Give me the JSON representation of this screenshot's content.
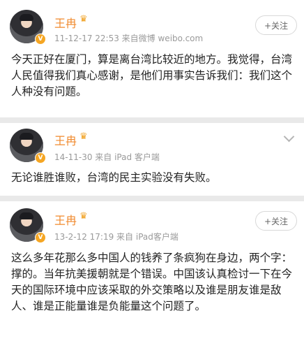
{
  "posts": [
    {
      "username": "王冉",
      "meta": "11-12-17 22:53 来自微博 weibo.com",
      "follow_label": "+关注",
      "content": "今天正好在厦门，算是离台湾比较近的地方。我觉得，台湾人民值得我们真心感谢，是他们用事实告诉我们：我们这个人种没有问题。"
    },
    {
      "username": "王冉",
      "meta": "14-11-30 来自 iPad 客户端",
      "content": "无论谁胜谁败，台湾的民主实验没有失败。"
    },
    {
      "username": "王冉",
      "meta": "13-2-12 17:19 来自 iPad客户端",
      "follow_label": "+关注",
      "content": "这么多年花那么多中国人的钱养了条疯狗在身边，两个字：撑的。当年抗美援朝就是个错误。中国该认真检讨一下在今天的国际环境中应该采取的外交策略以及谁是朋友谁是敌人、谁是正能量谁是负能量这个问题了。"
    }
  ],
  "icons": {
    "verified": "v-badge-icon",
    "member": "member-crown-icon",
    "more": "chevron-down-icon"
  },
  "colors": {
    "username": "#f08a2e",
    "verified": "#f5a623",
    "meta": "#9a9a9a"
  }
}
